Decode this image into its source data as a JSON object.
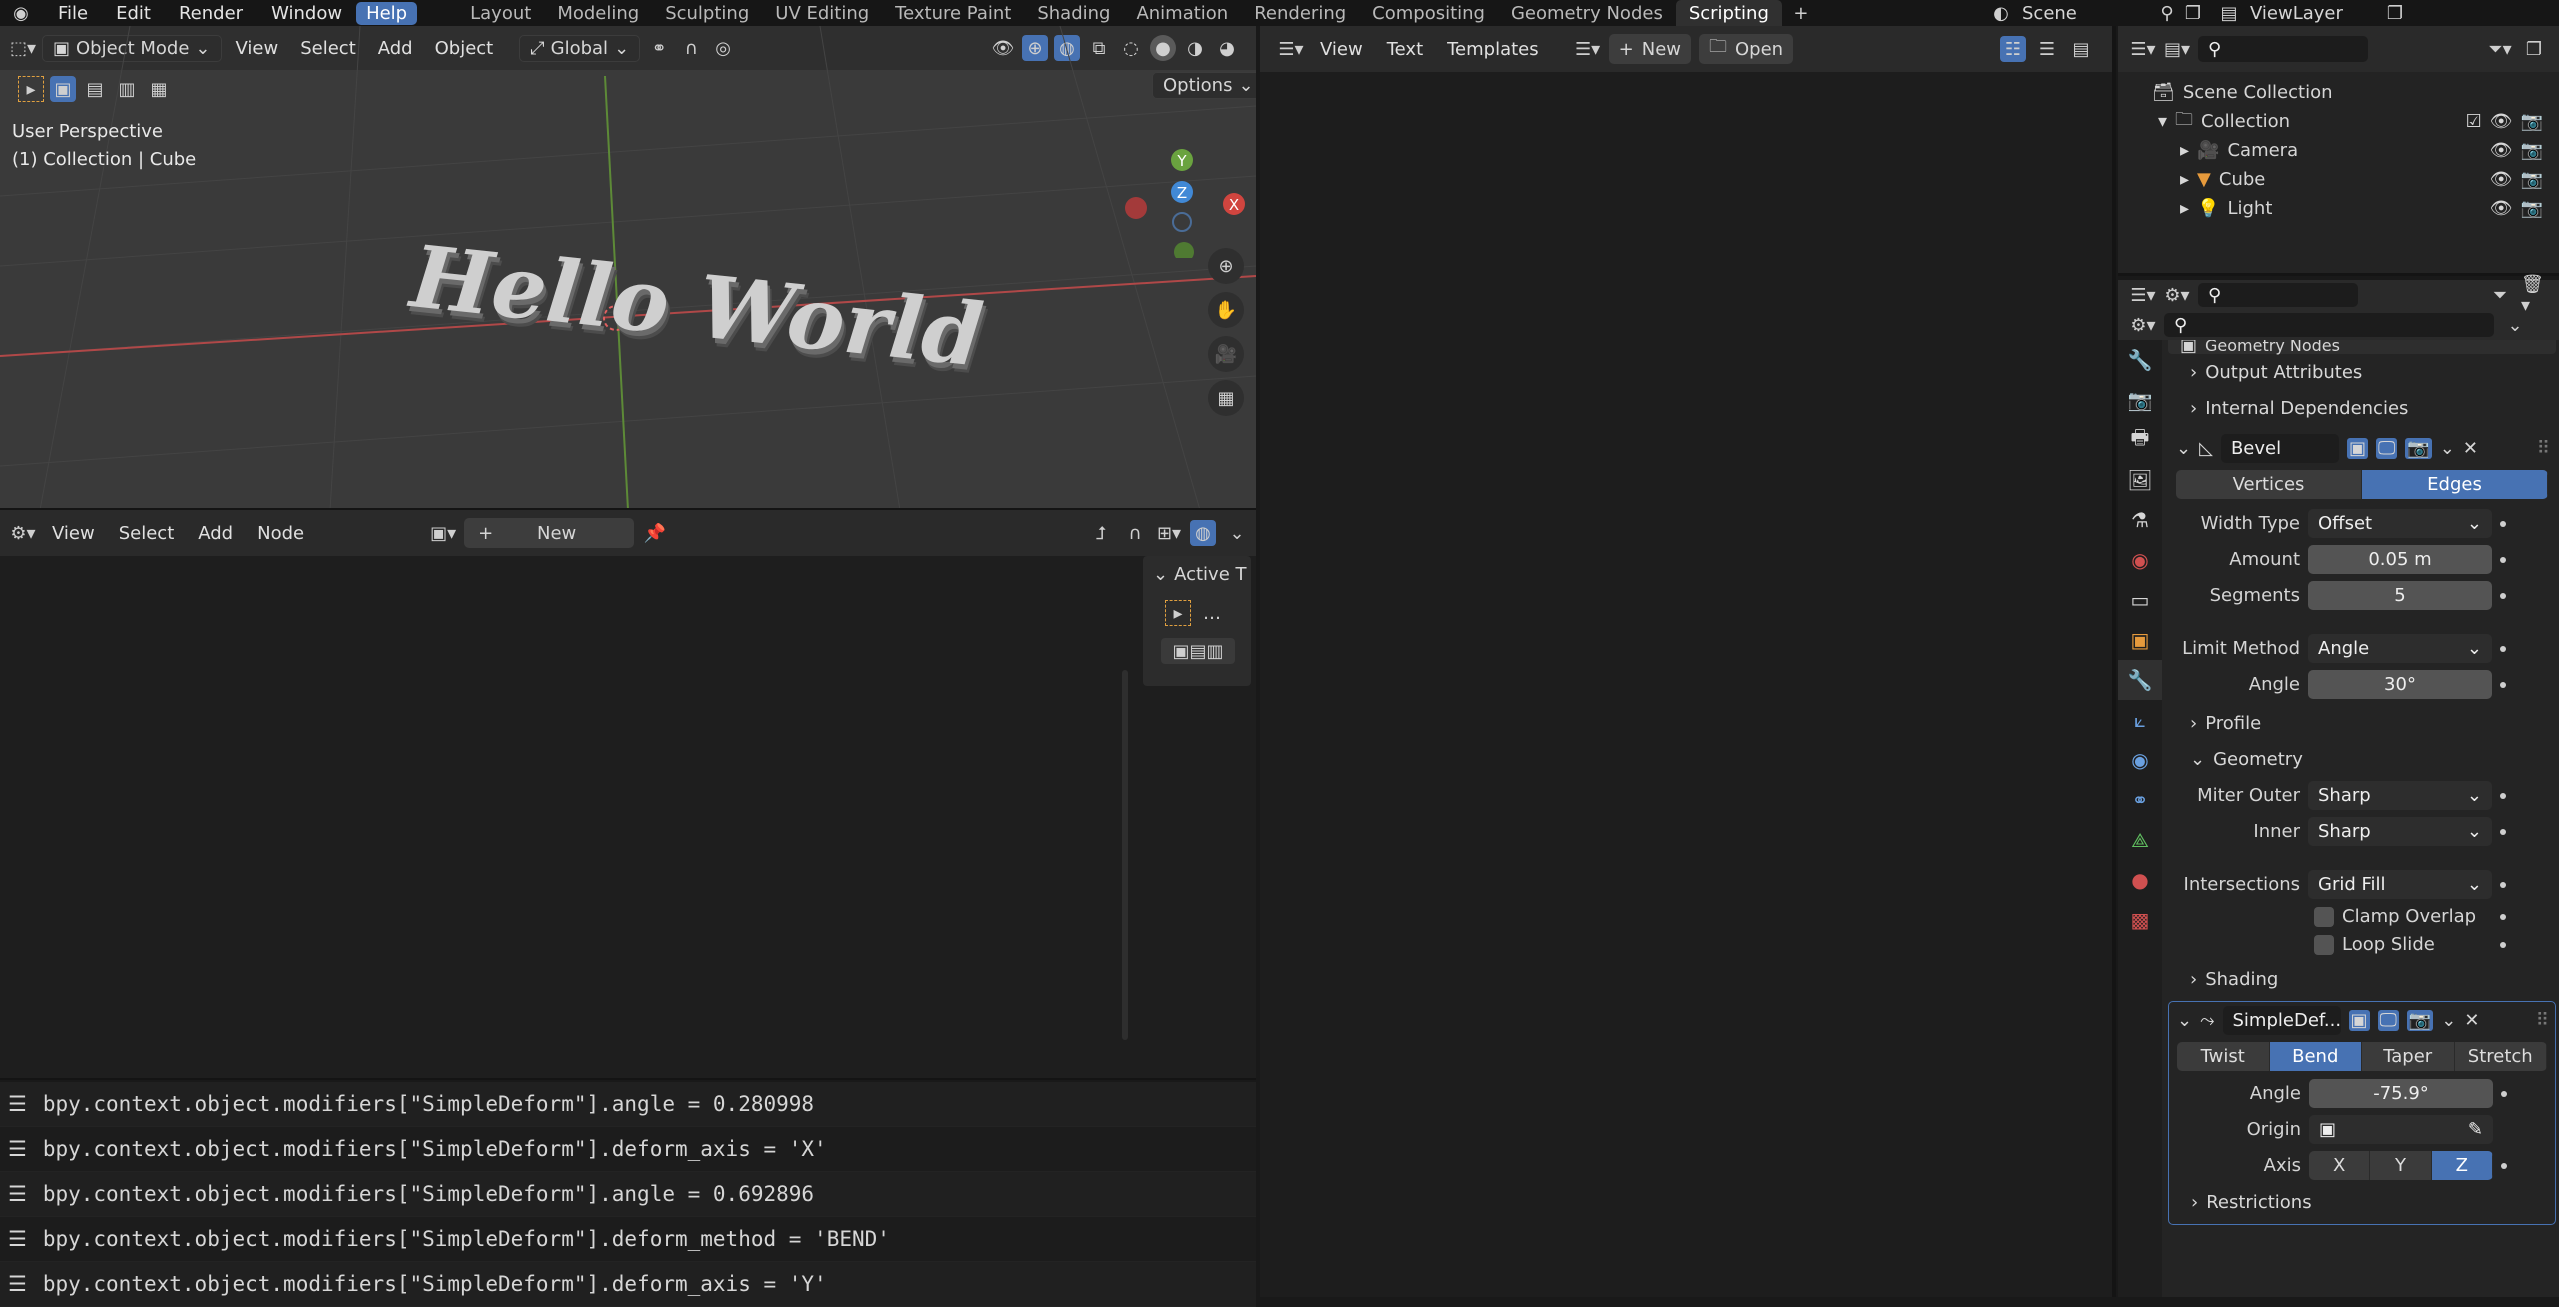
{
  "topbar": {
    "menus": [
      "File",
      "Edit",
      "Render",
      "Window",
      "Help"
    ],
    "workspaces": [
      "Layout",
      "Modeling",
      "Sculpting",
      "UV Editing",
      "Texture Paint",
      "Shading",
      "Animation",
      "Rendering",
      "Compositing",
      "Geometry Nodes",
      "Scripting"
    ],
    "active_workspace": "Scripting",
    "scene": "Scene",
    "view_layer": "ViewLayer"
  },
  "view3d": {
    "mode": "Object Mode",
    "menus": [
      "View",
      "Select",
      "Add",
      "Object"
    ],
    "orientation": "Global",
    "options": "Options",
    "overlay_line1": "User Perspective",
    "overlay_line2": "(1) Collection | Cube",
    "text_object": "Hello World",
    "gizmo": {
      "y": "Y",
      "z": "Z",
      "x": "X"
    }
  },
  "node_editor": {
    "menus": [
      "View",
      "Select",
      "Add",
      "Node"
    ],
    "new_label": "New",
    "side_panel_title": "Active T"
  },
  "console": {
    "lines": [
      "bpy.context.object.modifiers[\"SimpleDeform\"].angle = 0.280998",
      "bpy.context.object.modifiers[\"SimpleDeform\"].deform_axis = 'X'",
      "bpy.context.object.modifiers[\"SimpleDeform\"].angle = 0.692896",
      "bpy.context.object.modifiers[\"SimpleDeform\"].deform_method = 'BEND'",
      "bpy.context.object.modifiers[\"SimpleDeform\"].deform_axis = 'Y'"
    ]
  },
  "text_editor": {
    "menus": [
      "View",
      "Text",
      "Templates"
    ],
    "new_label": "New",
    "open_label": "Open"
  },
  "outliner": {
    "scene_collection": "Scene Collection",
    "collection": "Collection",
    "items": [
      {
        "name": "Camera",
        "color": "#c9874a"
      },
      {
        "name": "Cube",
        "color": "#e69a3c"
      },
      {
        "name": "Light",
        "color": "#e0a43a"
      }
    ]
  },
  "properties": {
    "geometry_nodes_header": "Geometry Nodes",
    "output_attributes": "Output Attributes",
    "internal_dependencies": "Internal Dependencies",
    "bevel": {
      "name": "Bevel",
      "affect": [
        "Vertices",
        "Edges"
      ],
      "affect_selected": "Edges",
      "width_type_label": "Width Type",
      "width_type": "Offset",
      "amount_label": "Amount",
      "amount": "0.05 m",
      "segments_label": "Segments",
      "segments": "5",
      "limit_method_label": "Limit Method",
      "limit_method": "Angle",
      "angle_label": "Angle",
      "angle": "30°",
      "profile": "Profile",
      "geometry": "Geometry",
      "miter_outer_label": "Miter Outer",
      "miter_outer": "Sharp",
      "inner_label": "Inner",
      "inner": "Sharp",
      "intersections_label": "Intersections",
      "intersections": "Grid Fill",
      "clamp_overlap": "Clamp Overlap",
      "loop_slide": "Loop Slide",
      "shading": "Shading"
    },
    "simple_deform": {
      "name": "SimpleDef...",
      "methods": [
        "Twist",
        "Bend",
        "Taper",
        "Stretch"
      ],
      "method_selected": "Bend",
      "angle_label": "Angle",
      "angle": "-75.9°",
      "origin_label": "Origin",
      "axis_label": "Axis",
      "axes": [
        "X",
        "Y",
        "Z"
      ],
      "axis_selected": "Z",
      "restrictions": "Restrictions"
    }
  },
  "colors": {
    "accent": "#4772b3",
    "x_axis": "#d0453f",
    "y_axis": "#6aa33f",
    "z_axis": "#4189d6"
  }
}
